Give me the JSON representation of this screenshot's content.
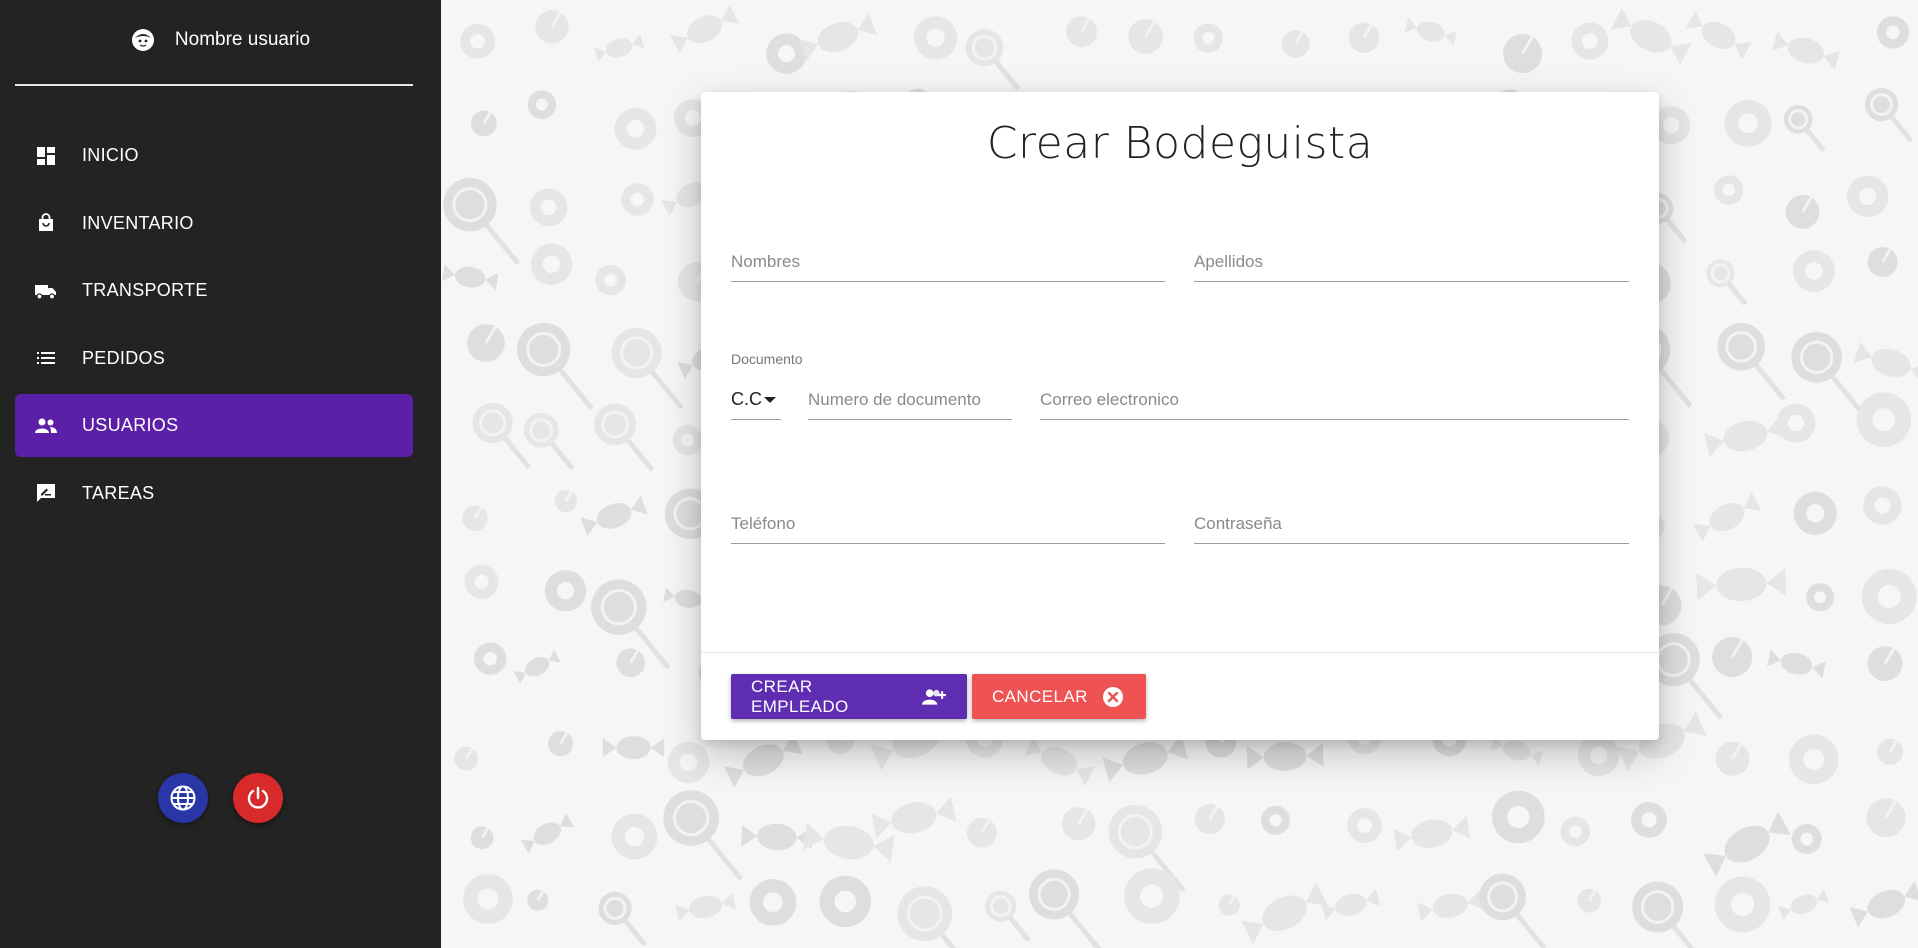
{
  "sidebar": {
    "user_name": "Nombre usuario",
    "items": [
      {
        "label": "INICIO",
        "icon": "dashboard-icon"
      },
      {
        "label": "INVENTARIO",
        "icon": "shopping-bag-icon"
      },
      {
        "label": "TRANSPORTE",
        "icon": "truck-icon"
      },
      {
        "label": "PEDIDOS",
        "icon": "list-icon"
      },
      {
        "label": "USUARIOS",
        "icon": "people-icon",
        "active": true
      },
      {
        "label": "TAREAS",
        "icon": "rate-review-icon"
      }
    ],
    "active_color": "#5c1fa8"
  },
  "form": {
    "title": "Crear Bodeguista",
    "nombres_placeholder": "Nombres",
    "apellidos_placeholder": "Apellidos",
    "documento_label": "Documento",
    "documento_type": "C.C",
    "numero_placeholder": "Numero de documento",
    "correo_placeholder": "Correo electronico",
    "telefono_placeholder": "Teléfono",
    "contrasena_placeholder": "Contraseña",
    "create_label": "CREAR EMPLEADO",
    "cancel_label": "CANCELAR",
    "create_color": "#5e2db2",
    "cancel_color": "#ee5253"
  }
}
